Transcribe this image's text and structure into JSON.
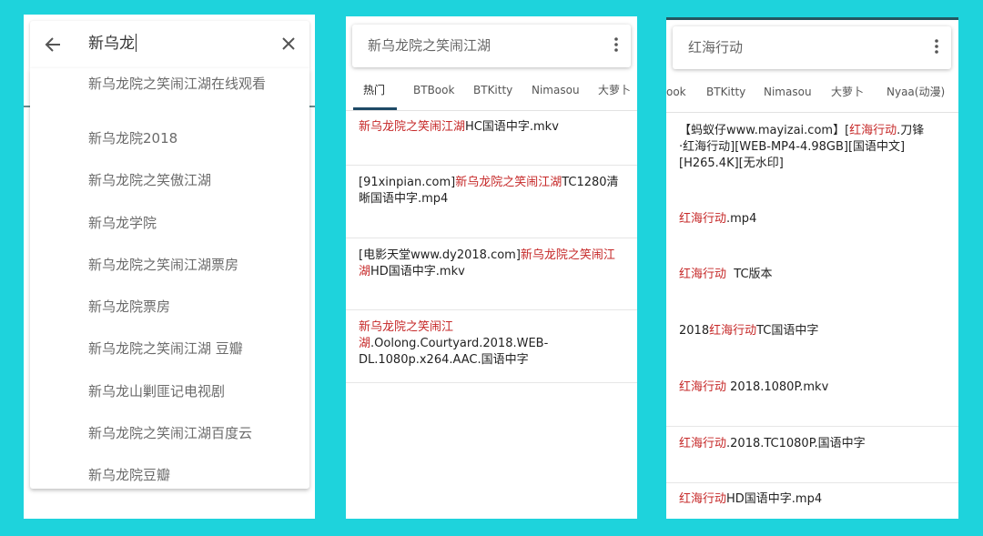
{
  "panel1": {
    "query": "新乌龙",
    "suggestions": [
      "新乌龙院之笑闹江湖在线观看",
      "新乌龙院2018",
      "新乌龙院之笑傲江湖",
      "新乌龙学院",
      "新乌龙院之笑闹江湖票房",
      "新乌龙院票房",
      "新乌龙院之笑闹江湖 豆瓣",
      "新乌龙山剿匪记电视剧",
      "新乌龙院之笑闹江湖百度云",
      "新乌龙院豆瓣"
    ]
  },
  "panel2": {
    "query": "新乌龙院之笑闹江湖",
    "tabs": [
      "热门",
      "BTBook",
      "BTKitty",
      "Nimasou",
      "大萝卜"
    ],
    "active_tab": "热门",
    "results": [
      {
        "prefix": "",
        "highlight": "新乌龙院之笑闹江湖",
        "suffix": "HC国语中字.mkv"
      },
      {
        "prefix": "[91xinpian.com]",
        "highlight": "新乌龙院之笑闹江湖",
        "suffix": "TC1280清晰国语中字.mp4"
      },
      {
        "prefix": "[电影天堂www.dy2018.com]",
        "highlight": "新乌龙院之笑闹江湖",
        "suffix": "HD国语中字.mkv"
      },
      {
        "prefix": "",
        "highlight": "新乌龙院之笑闹江湖",
        "suffix": ".Oolong.Courtyard.2018.WEB-DL.1080p.x264.AAC.国语中字"
      }
    ]
  },
  "panel3": {
    "query": "红海行动",
    "tabs": [
      "ook",
      "BTKitty",
      "Nimasou",
      "大萝卜",
      "Nyaa(动漫)"
    ],
    "results": [
      {
        "prefix": "【蚂蚁仔www.mayizai.com】[",
        "highlight": "红海行动",
        "suffix": ".刀锋·红海行动][WEB-MP4-4.98GB][国语中文][H265.4K][无水印]"
      },
      {
        "prefix": "",
        "highlight": "红海行动",
        "suffix": ".mp4"
      },
      {
        "prefix": "",
        "highlight": "红海行动",
        "suffix": "  TC版本"
      },
      {
        "prefix": "2018",
        "highlight": "红海行动",
        "suffix": "TC国语中字"
      },
      {
        "prefix": "",
        "highlight": "红海行动",
        "suffix": " 2018.1080P.mkv"
      },
      {
        "prefix": "",
        "highlight": "红海行动",
        "suffix": ".2018.TC1080P.国语中字"
      },
      {
        "prefix": "",
        "highlight": "红海行动",
        "suffix": "HD国语中字.mp4"
      }
    ]
  },
  "icons": {
    "back": "arrow-back-icon",
    "clear": "close-icon",
    "menu": "more-vert-icon"
  },
  "colors": {
    "background": "#1ed3dc",
    "highlight": "#c62828",
    "tab_indicator": "#1e4a66"
  }
}
